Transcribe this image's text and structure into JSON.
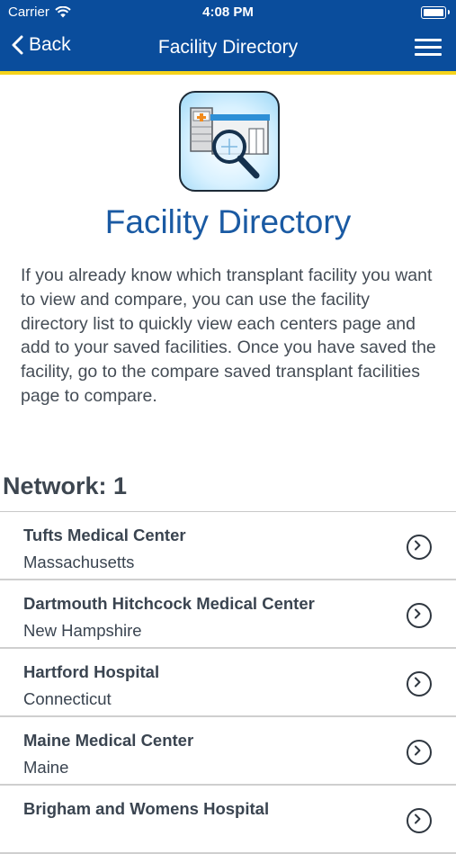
{
  "status_bar": {
    "carrier": "Carrier",
    "time": "4:08 PM"
  },
  "nav": {
    "back_label": "Back",
    "title": "Facility Directory"
  },
  "hero": {
    "title": "Facility Directory",
    "intro": "If you already know which transplant facility you want to view and compare, you can use the facility directory list to quickly view each centers page and add to your saved facilities. Once you have saved the facility, go to the compare saved transplant facilities page to compare."
  },
  "network": {
    "label": "Network: 1"
  },
  "facilities": [
    {
      "name": "Tufts Medical Center",
      "state": "Massachusetts"
    },
    {
      "name": "Dartmouth Hitchcock Medical Center",
      "state": "New Hampshire"
    },
    {
      "name": "Hartford Hospital",
      "state": "Connecticut"
    },
    {
      "name": "Maine Medical Center",
      "state": "Maine"
    },
    {
      "name": "Brigham and Womens Hospital",
      "state": ""
    }
  ],
  "colors": {
    "nav_bg": "#0a4d9c",
    "accent_bar": "#f5d31a",
    "title_blue": "#1a5aa3"
  }
}
